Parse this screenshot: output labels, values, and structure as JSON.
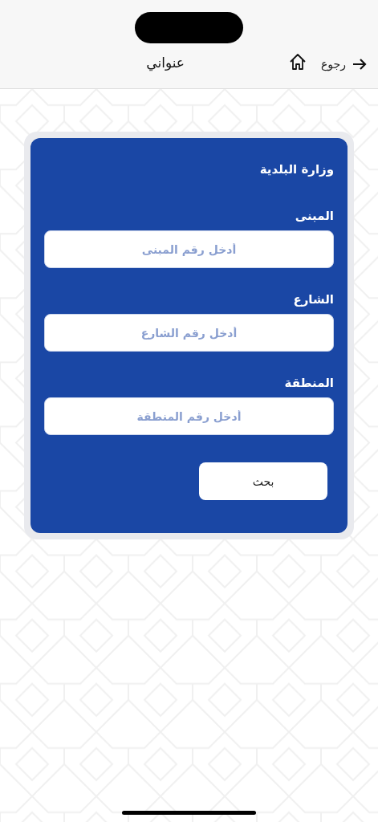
{
  "header": {
    "back_label": "رجوع",
    "title": "عنواني"
  },
  "form": {
    "title": "وزارة البلدية",
    "fields": [
      {
        "label": "المبنى",
        "placeholder": "أدخل رقم المبنى"
      },
      {
        "label": "الشارع",
        "placeholder": "أدخل رقم الشارع"
      },
      {
        "label": "المنطقة",
        "placeholder": "أدخل رقم المنطقة"
      }
    ],
    "submit": "بحث"
  }
}
